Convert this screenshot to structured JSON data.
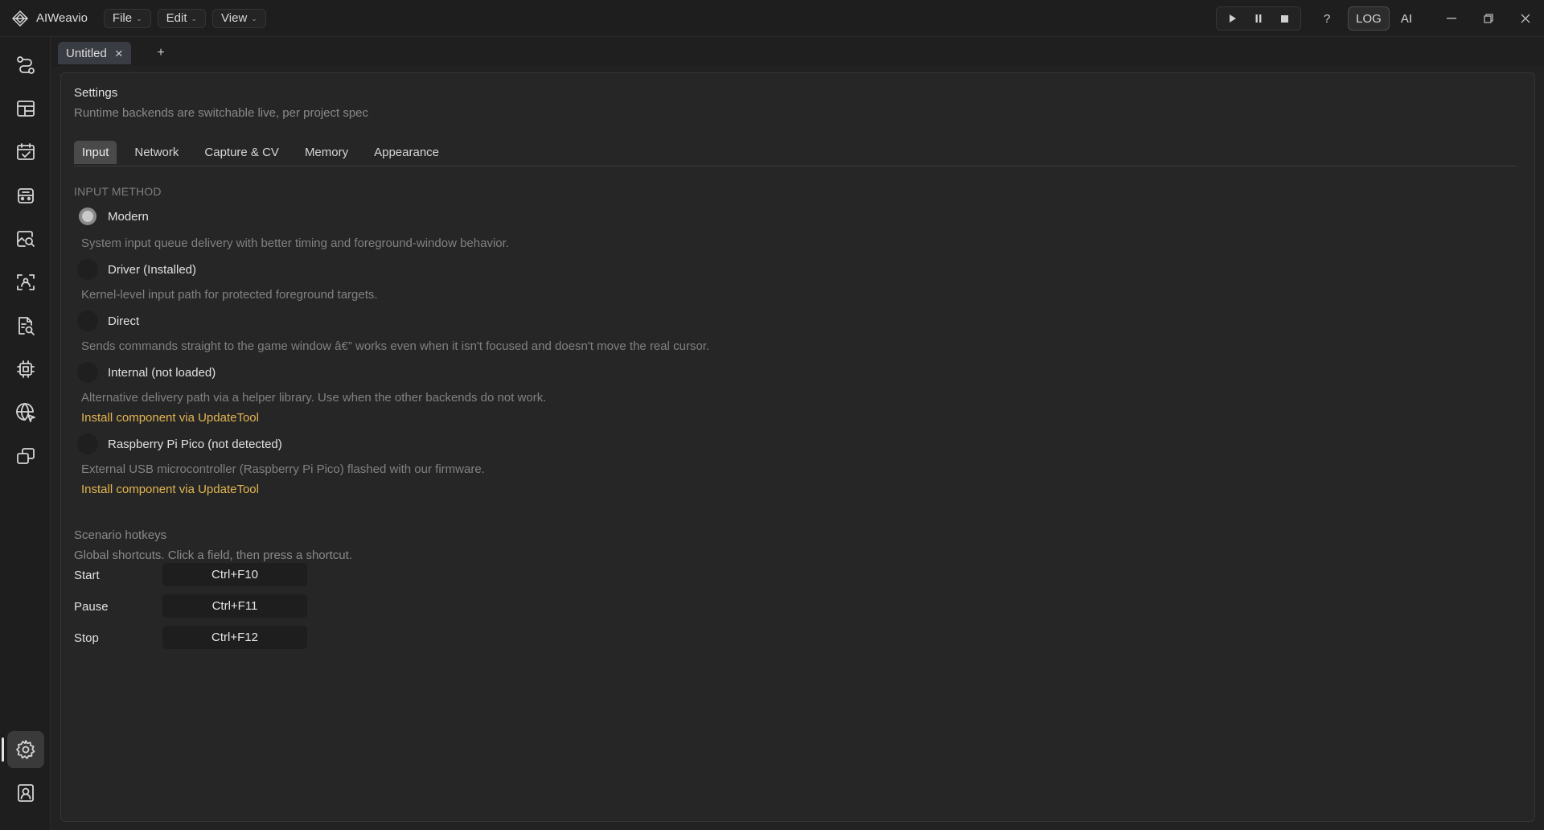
{
  "app": {
    "name": "AIWeavio"
  },
  "menus": [
    {
      "label": "File"
    },
    {
      "label": "Edit"
    },
    {
      "label": "View"
    }
  ],
  "toolbar": {
    "help": "?",
    "log": "LOG",
    "ai": "AI"
  },
  "document_tab": {
    "label": "Untitled",
    "add": "+"
  },
  "settings": {
    "title": "Settings",
    "subtitle": "Runtime backends are switchable live, per project spec",
    "tabs": [
      "Input",
      "Network",
      "Capture & CV",
      "Memory",
      "Appearance"
    ],
    "active_tab": "Input",
    "input_method_label": "INPUT METHOD",
    "options": [
      {
        "label": "Modern",
        "selected": true,
        "description": "System input queue delivery with better timing and foreground-window behavior."
      },
      {
        "label": "Driver (Installed)",
        "selected": false,
        "description": "Kernel-level input path for protected foreground targets."
      },
      {
        "label": "Direct",
        "selected": false,
        "description": "Sends commands straight to the game window â€” works even when it isn't focused and doesn't move the real cursor."
      },
      {
        "label": "Internal (not loaded)",
        "selected": false,
        "description": "Alternative delivery path via a helper library. Use when the other backends do not work.",
        "install_link": "Install component via UpdateTool"
      },
      {
        "label": "Raspberry Pi Pico (not detected)",
        "selected": false,
        "description": "External USB microcontroller (Raspberry Pi Pico) flashed with our firmware.",
        "install_link": "Install component via UpdateTool"
      }
    ],
    "hotkeys": {
      "title": "Scenario hotkeys",
      "subtitle": "Global shortcuts. Click a field, then press a shortcut.",
      "items": [
        {
          "name": "Start",
          "shortcut": "Ctrl+F10"
        },
        {
          "name": "Pause",
          "shortcut": "Ctrl+F11"
        },
        {
          "name": "Stop",
          "shortcut": "Ctrl+F12"
        }
      ]
    }
  },
  "sidebar": {
    "items": [
      {
        "icon": "workflow-icon"
      },
      {
        "icon": "layout-icon"
      },
      {
        "icon": "calendar-check-icon"
      },
      {
        "icon": "robot-icon"
      },
      {
        "icon": "image-search-icon"
      },
      {
        "icon": "scan-focus-icon"
      },
      {
        "icon": "document-search-icon"
      },
      {
        "icon": "chip-icon"
      },
      {
        "icon": "globe-cursor-icon"
      },
      {
        "icon": "windows-stack-icon"
      },
      {
        "icon": "gear-icon",
        "active": true
      },
      {
        "icon": "user-badge-icon"
      }
    ]
  },
  "colors": {
    "background": "#222222",
    "panel": "#262626",
    "accent_link": "#e2b552",
    "active_tab": "#4a4a4a"
  }
}
